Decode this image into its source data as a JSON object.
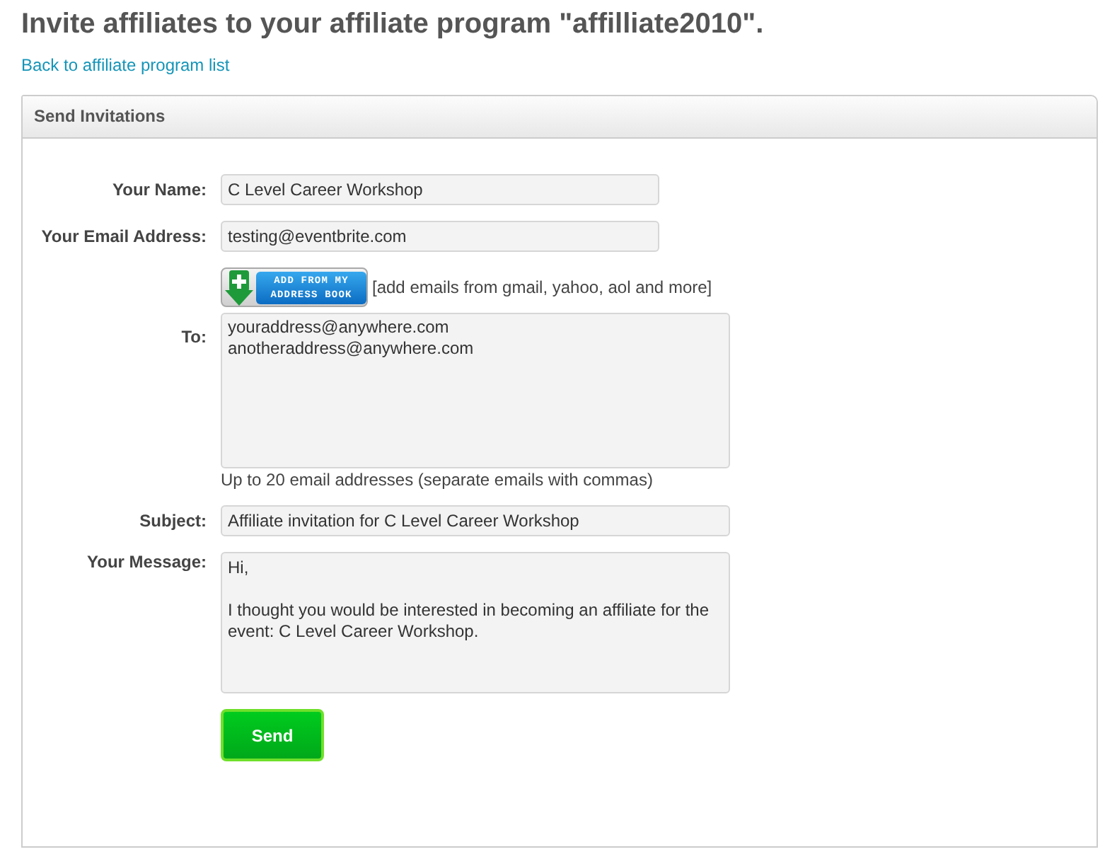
{
  "title": "Invite affiliates to your affiliate program \"affilliate2010\".",
  "back_link": "Back to affiliate program list",
  "panel": {
    "title": "Send Invitations",
    "your_name": {
      "label": "Your Name:",
      "value": "C Level Career Workshop"
    },
    "your_email": {
      "label": "Your Email Address:",
      "value": "testing@eventbrite.com"
    },
    "address_book": {
      "button": "ADD FROM MY ADDRESS BOOK",
      "note": "[add emails from gmail, yahoo, aol and more]"
    },
    "to": {
      "label": "To:",
      "value": "youraddress@anywhere.com\nanotheraddress@anywhere.com",
      "hint": "Up to 20 email addresses (separate emails with commas)"
    },
    "subject": {
      "label": "Subject:",
      "value": "Affiliate invitation for C Level Career Workshop"
    },
    "message": {
      "label": "Your Message:",
      "value": "Hi,\n\nI thought you would be interested in becoming an affiliate for the event: C Level Career Workshop."
    },
    "send_button": "Send"
  }
}
